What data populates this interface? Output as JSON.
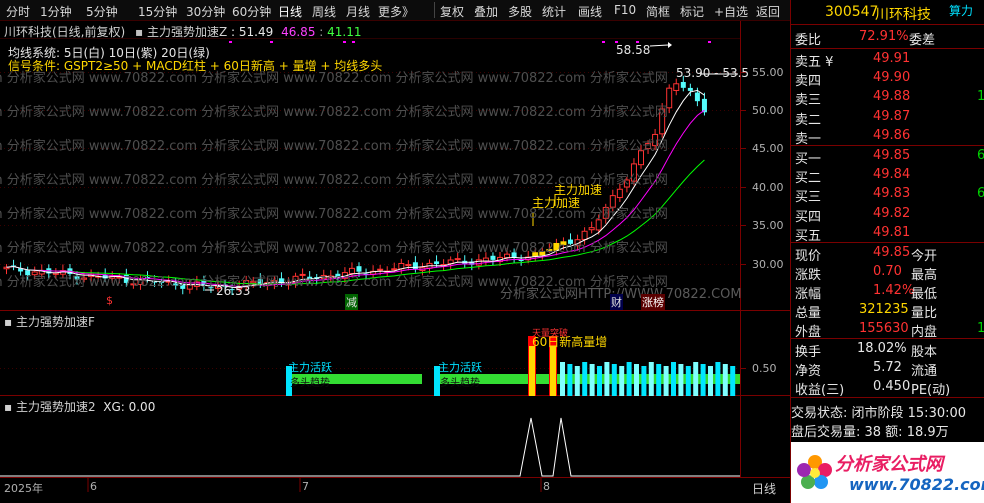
{
  "toolbar": {
    "items": [
      "分时",
      "1分钟",
      "5分钟",
      "15分钟",
      "30分钟",
      "60分钟",
      "日线",
      "周线",
      "月线",
      "更多》"
    ],
    "right_items": [
      "复权",
      "叠加",
      "多股",
      "统计",
      "画线",
      "F10",
      "简框",
      "标记",
      "+自选",
      "返回"
    ],
    "active": "日线"
  },
  "main_chart": {
    "title": "川环科技(日线,前复权)",
    "indicator_name": "主力强势加速Z",
    "ind_values": [
      ": 51.49",
      "46.85",
      "41.11"
    ],
    "ma_line": "均线系统: 5日(白) 10日(紫) 20日(绿)",
    "signal_line": "信号条件: GSPT2≥50 + MACD红柱 + 60日新高 + 量增 + 均线多头",
    "y_ticks": [
      "55.00",
      "50.00",
      "45.00",
      "40.00",
      "35.00",
      "30.00"
    ],
    "high_label": "58.58",
    "last_label": "53.90 - 53.5",
    "low_label": "26.53",
    "annotations": [
      "主力加速",
      "主力加速"
    ],
    "events": [
      "$",
      "减",
      "财",
      "涨榜"
    ],
    "watermark": "分析家公式网HTTP://WWW.70822.COM"
  },
  "sub1": {
    "title": "主力强势加速F",
    "y_tick": "0.50",
    "labels": [
      "主力活跃",
      "主力活跃",
      "多头趋势",
      "多头趋势",
      "60日新高量增",
      "天量突破"
    ]
  },
  "sub2": {
    "title": "主力强势加速2",
    "value": "XG: 0.00"
  },
  "date_axis": [
    "2025年",
    "6",
    "7",
    "8"
  ],
  "period_label": "日线",
  "quote": {
    "code": "300547",
    "name": "川环科技",
    "power_label": "算力",
    "weibi": {
      "label": "委比",
      "value": "72.91%",
      "label2": "委差"
    },
    "asks": [
      {
        "label": "卖五 ¥",
        "price": "49.91"
      },
      {
        "label": "卖四",
        "price": "49.90"
      },
      {
        "label": "卖三",
        "price": "49.88",
        "vol": "1"
      },
      {
        "label": "卖二",
        "price": "49.87"
      },
      {
        "label": "卖一",
        "price": "49.86"
      }
    ],
    "bids": [
      {
        "label": "买一",
        "price": "49.85",
        "vol": "6"
      },
      {
        "label": "买二",
        "price": "49.84"
      },
      {
        "label": "买三",
        "price": "49.83",
        "vol": "6"
      },
      {
        "label": "买四",
        "price": "49.82"
      },
      {
        "label": "买五",
        "price": "49.81"
      }
    ],
    "stats": [
      {
        "l1": "现价",
        "v1": "49.85",
        "l2": "今开"
      },
      {
        "l1": "涨跌",
        "v1": "0.70",
        "l2": "最高"
      },
      {
        "l1": "涨幅",
        "v1": "1.42%",
        "l2": "最低"
      },
      {
        "l1": "总量",
        "v1": "321235",
        "l2": "量比"
      },
      {
        "l1": "外盘",
        "v1": "155630",
        "l2": "内盘",
        "v2": "1"
      }
    ],
    "stats2": [
      {
        "l1": "换手",
        "v1": "18.02%",
        "l2": "股本"
      },
      {
        "l1": "净资",
        "v1": "5.72",
        "l2": "流通"
      },
      {
        "l1": "收益(三)",
        "v1": "0.450",
        "l2": "PE(动)"
      }
    ],
    "trade_state": "交易状态: 闭市阶段 15:30:00",
    "after_hours": "盘后交易量: 38  额: 18.9万"
  },
  "logo": {
    "text": "分析家公式网",
    "url": "www.70822.com"
  },
  "colors": {
    "up": "#ff3232",
    "down": "#54fcfc",
    "ma5": "#ffffff",
    "ma10": "#ff00ff",
    "ma20": "#00ff00",
    "accent": "#ffd700"
  }
}
